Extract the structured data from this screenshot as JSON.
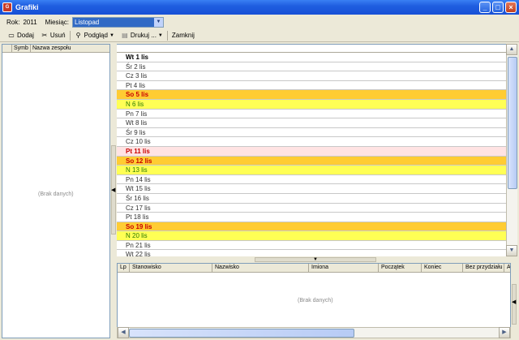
{
  "window": {
    "title": "Grafiki",
    "app_icon": "grafiki-app-icon"
  },
  "filter": {
    "year_label": "Rok:",
    "year_value": "2011",
    "month_label": "Miesiąc:",
    "month_value": "Listopad"
  },
  "toolbar": {
    "add": "Dodaj",
    "delete": "Usuń",
    "preview": "Podgląd",
    "print": "Drukuj ...",
    "close": "Zamknij"
  },
  "teams": {
    "columns": [
      "Symb",
      "Nazwa zespołu"
    ],
    "empty": "(Brak danych)"
  },
  "days": [
    {
      "label": "Wt 1 lis",
      "type": "current"
    },
    {
      "label": "Śr 2 lis",
      "type": "normal"
    },
    {
      "label": "Cz 3 lis",
      "type": "normal"
    },
    {
      "label": "Pt 4 lis",
      "type": "normal"
    },
    {
      "label": "So 5 lis",
      "type": "sat"
    },
    {
      "label": "N 6 lis",
      "type": "sun"
    },
    {
      "label": "Pn 7 lis",
      "type": "normal"
    },
    {
      "label": "Wt 8 lis",
      "type": "normal"
    },
    {
      "label": "Śr 9 lis",
      "type": "normal"
    },
    {
      "label": "Cz 10 lis",
      "type": "normal"
    },
    {
      "label": "Pt 11 lis",
      "type": "holiday"
    },
    {
      "label": "So 12 lis",
      "type": "sat"
    },
    {
      "label": "N 13 lis",
      "type": "sun"
    },
    {
      "label": "Pn 14 lis",
      "type": "normal"
    },
    {
      "label": "Wt 15 lis",
      "type": "normal"
    },
    {
      "label": "Śr 16 lis",
      "type": "normal"
    },
    {
      "label": "Cz 17 lis",
      "type": "normal"
    },
    {
      "label": "Pt 18 lis",
      "type": "normal"
    },
    {
      "label": "So 19 lis",
      "type": "sat"
    },
    {
      "label": "N 20 lis",
      "type": "sun"
    },
    {
      "label": "Pn 21 lis",
      "type": "normal"
    },
    {
      "label": "Wt 22 lis",
      "type": "normal"
    }
  ],
  "shifts": {
    "columns": [
      "Lp",
      "Stanowisko",
      "Nazwisko",
      "Imiona",
      "Początek",
      "Koniec",
      "Bez przydziału",
      "Ak"
    ],
    "empty": "(Brak danych)"
  },
  "colors": {
    "saturday": "#ffcc33",
    "sunday": "#ffff55",
    "holiday": "#ffe3e3",
    "titlebar": "#1f5ee0"
  }
}
